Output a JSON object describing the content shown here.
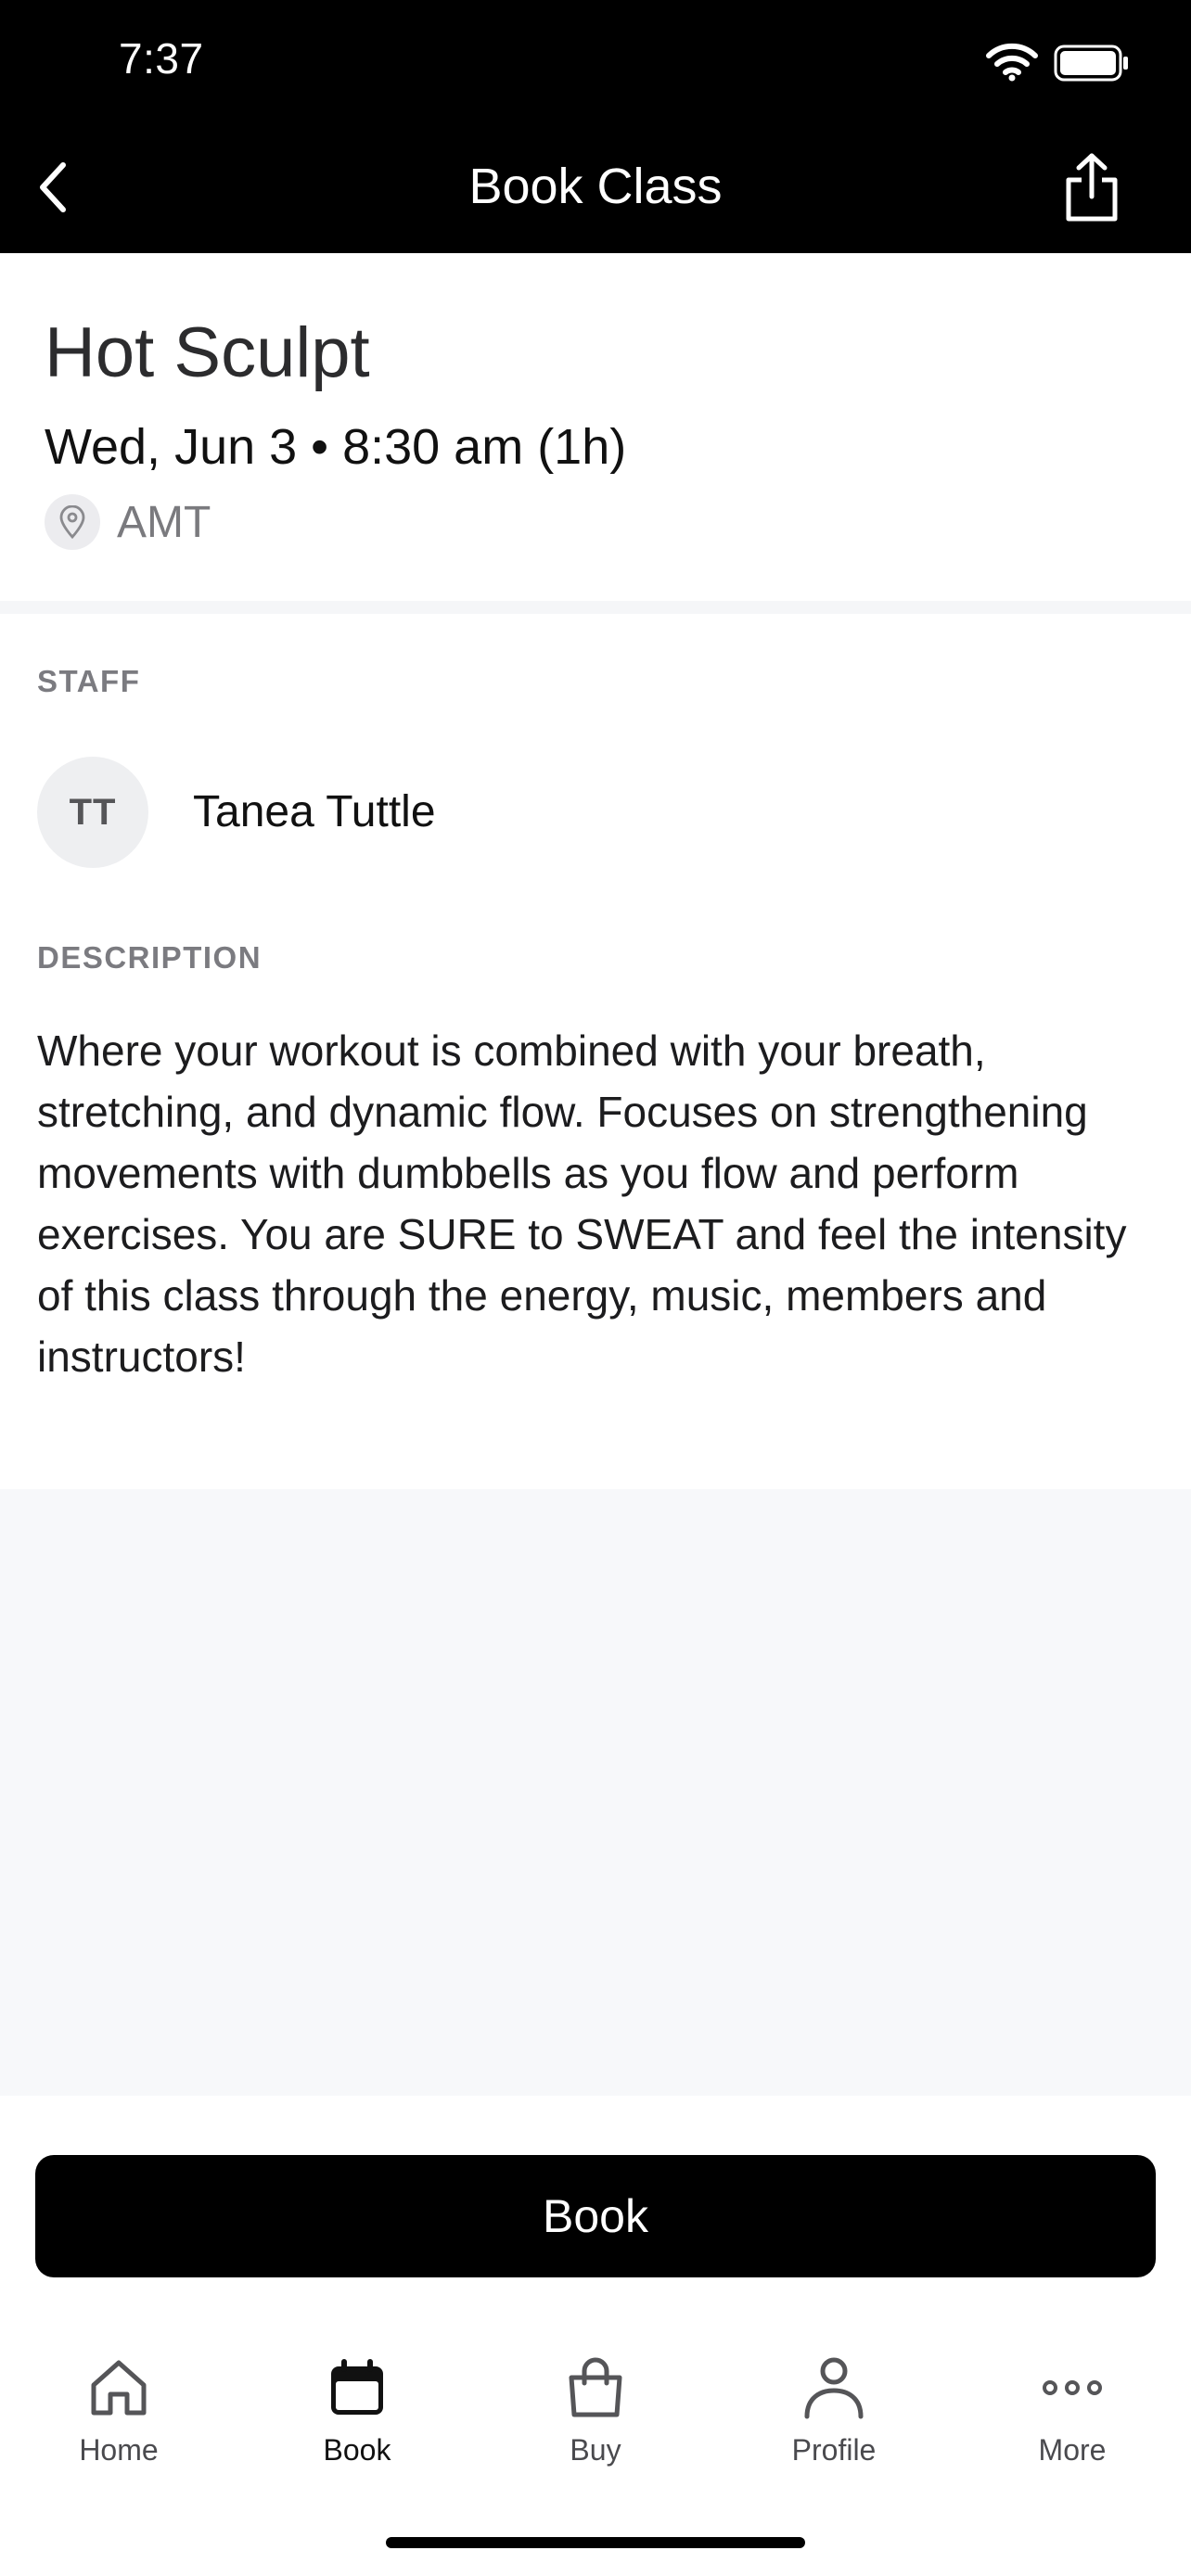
{
  "status_bar": {
    "time": "7:37"
  },
  "header": {
    "title": "Book Class"
  },
  "class_info": {
    "name": "Hot Sculpt",
    "datetime": "Wed, Jun 3 • 8:30 am (1h)",
    "location": "AMT"
  },
  "staff": {
    "section_label": "STAFF",
    "initials": "TT",
    "name": "Tanea Tuttle"
  },
  "description": {
    "section_label": "DESCRIPTION",
    "text": "Where your workout is combined with your breath, stretching, and dynamic flow. Focuses on strengthening movements with dumbbells as you flow and perform exercises. You are SURE to SWEAT and feel the intensity of this class through the energy, music, members and instructors!"
  },
  "actions": {
    "book_label": "Book"
  },
  "tabs": [
    {
      "label": "Home",
      "icon": "home-icon",
      "active": false
    },
    {
      "label": "Book",
      "icon": "calendar-icon",
      "active": true
    },
    {
      "label": "Buy",
      "icon": "shopping-bag-icon",
      "active": false
    },
    {
      "label": "Profile",
      "icon": "person-icon",
      "active": false
    },
    {
      "label": "More",
      "icon": "more-icon",
      "active": false
    }
  ],
  "colors": {
    "header_bg": "#000000",
    "accent": "#000000",
    "label_gray": "#7b7b80",
    "empty_area_bg": "#f7f8fa"
  }
}
